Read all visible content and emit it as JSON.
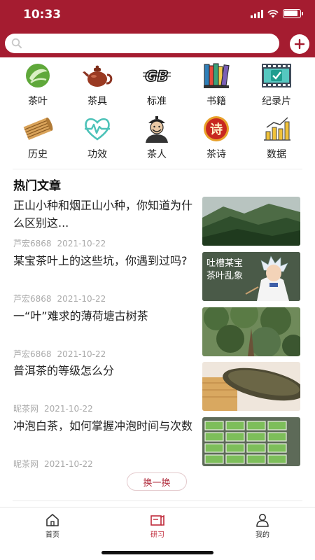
{
  "status_bar": {
    "time": "10:33"
  },
  "search": {
    "placeholder": ""
  },
  "categories": [
    {
      "label": "茶叶",
      "icon": "tea-leaf-icon"
    },
    {
      "label": "茶具",
      "icon": "teapot-icon"
    },
    {
      "label": "标准",
      "icon": "gb-standard-icon"
    },
    {
      "label": "书籍",
      "icon": "books-icon"
    },
    {
      "label": "纪录片",
      "icon": "film-icon"
    },
    {
      "label": "历史",
      "icon": "bamboo-scroll-icon"
    },
    {
      "label": "功效",
      "icon": "heart-pulse-icon"
    },
    {
      "label": "茶人",
      "icon": "tea-person-icon"
    },
    {
      "label": "茶诗",
      "icon": "poem-icon"
    },
    {
      "label": "数据",
      "icon": "bar-chart-icon"
    }
  ],
  "section": {
    "title": "热门文章"
  },
  "articles": [
    {
      "title": "正山小种和烟正山小种，你知道为什么区别这...",
      "author": "芦宏6868",
      "date": "2021-10-22",
      "thumb": "mountain-forest-image"
    },
    {
      "title": "某宝茶叶上的这些坑，你遇到过吗?",
      "author": "芦宏6868",
      "date": "2021-10-22",
      "thumb": "anime-teacher-image",
      "thumb_caption": [
        "吐槽某宝",
        "茶叶乱象"
      ]
    },
    {
      "title": "一“叶”难求的薄荷塘古树茶",
      "author": "芦宏6868",
      "date": "2021-10-22",
      "thumb": "old-tea-tree-image"
    },
    {
      "title": "普洱茶的等级怎么分",
      "author": "昵茶网",
      "date": "2021-10-22",
      "thumb": "puer-tea-cake-image"
    },
    {
      "title": "冲泡白茶，如何掌握冲泡时间与次数",
      "author": "昵茶网",
      "date": "2021-10-22",
      "thumb": "tea-trays-image"
    }
  ],
  "refresh_label": "换一换",
  "tabs": [
    {
      "label": "首页",
      "icon": "home-icon",
      "active": false
    },
    {
      "label": "研习",
      "icon": "study-icon",
      "active": true
    },
    {
      "label": "我的",
      "icon": "profile-icon",
      "active": false
    }
  ],
  "colors": {
    "brand": "#a51c30",
    "active_tab": "#c02a3a"
  }
}
